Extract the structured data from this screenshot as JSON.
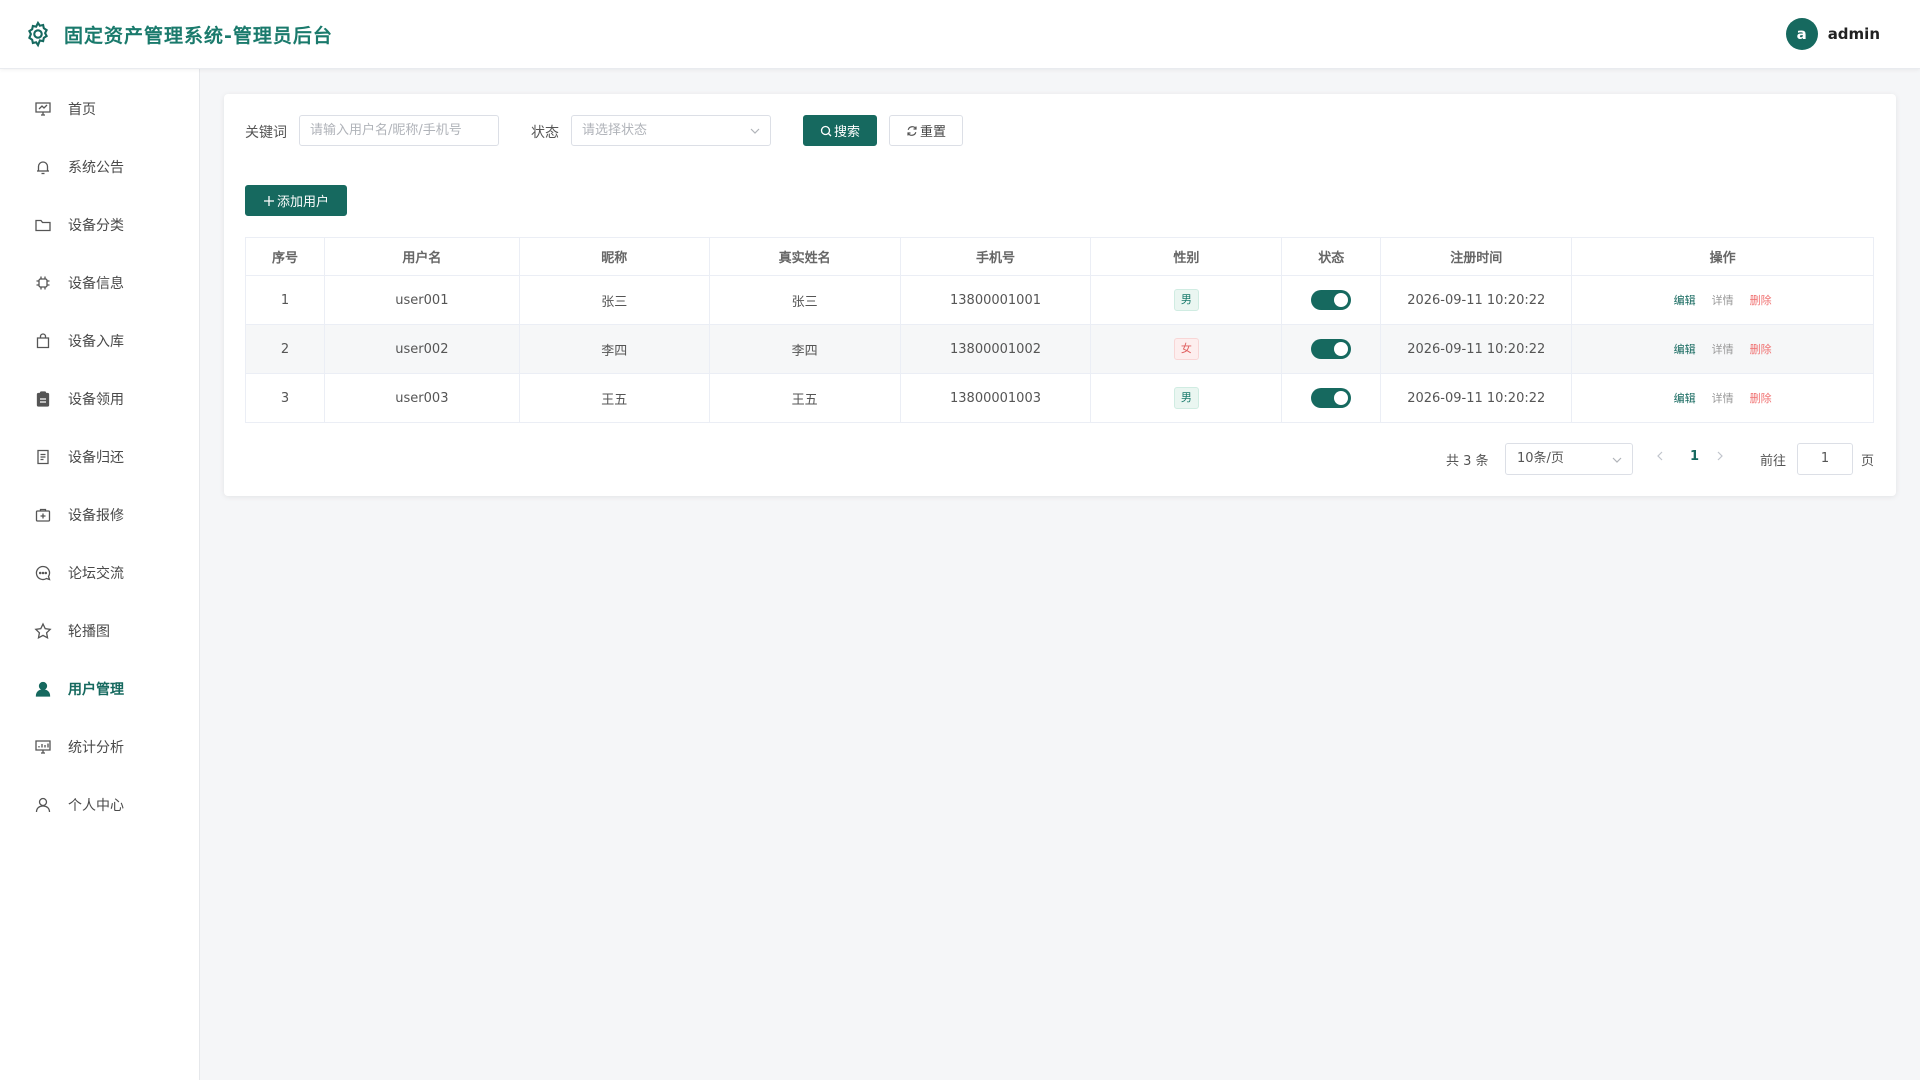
{
  "header": {
    "title": "固定资产管理系统-管理员后台",
    "avatar_letter": "a",
    "username": "admin",
    "accent": "#16695f",
    "title_color": "#1a7a6c"
  },
  "sidebar": {
    "items": [
      {
        "label": "首页",
        "icon": "dashboard-icon"
      },
      {
        "label": "系统公告",
        "icon": "bell-icon"
      },
      {
        "label": "设备分类",
        "icon": "folder-icon"
      },
      {
        "label": "设备信息",
        "icon": "chip-icon"
      },
      {
        "label": "设备入库",
        "icon": "bag-icon"
      },
      {
        "label": "设备领用",
        "icon": "clipboard-icon"
      },
      {
        "label": "设备归还",
        "icon": "document-icon"
      },
      {
        "label": "设备报修",
        "icon": "repair-kit-icon"
      },
      {
        "label": "论坛交流",
        "icon": "chat-icon"
      },
      {
        "label": "轮播图",
        "icon": "star-icon"
      },
      {
        "label": "用户管理",
        "icon": "user-filled-icon",
        "active": true
      },
      {
        "label": "统计分析",
        "icon": "chart-icon"
      },
      {
        "label": "个人中心",
        "icon": "user-icon"
      }
    ]
  },
  "filter": {
    "keyword_label": "关键词",
    "keyword_placeholder": "请输入用户名/昵称/手机号",
    "status_label": "状态",
    "status_placeholder": "请选择状态",
    "search_label": "搜索",
    "reset_label": "重置"
  },
  "toolbar": {
    "add_label": "添加用户"
  },
  "table": {
    "columns": [
      "序号",
      "用户名",
      "昵称",
      "真实姓名",
      "手机号",
      "性别",
      "状态",
      "注册时间",
      "操作"
    ],
    "rows": [
      {
        "index": "1",
        "username": "user001",
        "nickname": "张三",
        "realname": "张三",
        "phone": "13800001001",
        "gender": "男",
        "enabled": true,
        "registered": "2026-09-11 10:20:22"
      },
      {
        "index": "2",
        "username": "user002",
        "nickname": "李四",
        "realname": "李四",
        "phone": "13800001002",
        "gender": "女",
        "enabled": true,
        "registered": "2026-09-11 10:20:22"
      },
      {
        "index": "3",
        "username": "user003",
        "nickname": "王五",
        "realname": "王五",
        "phone": "13800001003",
        "gender": "男",
        "enabled": true,
        "registered": "2026-09-11 10:20:22"
      }
    ],
    "actions": {
      "edit": "编辑",
      "detail": "详情",
      "delete": "删除"
    }
  },
  "pagination": {
    "total": "共 3 条",
    "page_size": "10条/页",
    "current": "1",
    "goto_label": "前往",
    "goto_value": "1",
    "page_label": "页"
  }
}
